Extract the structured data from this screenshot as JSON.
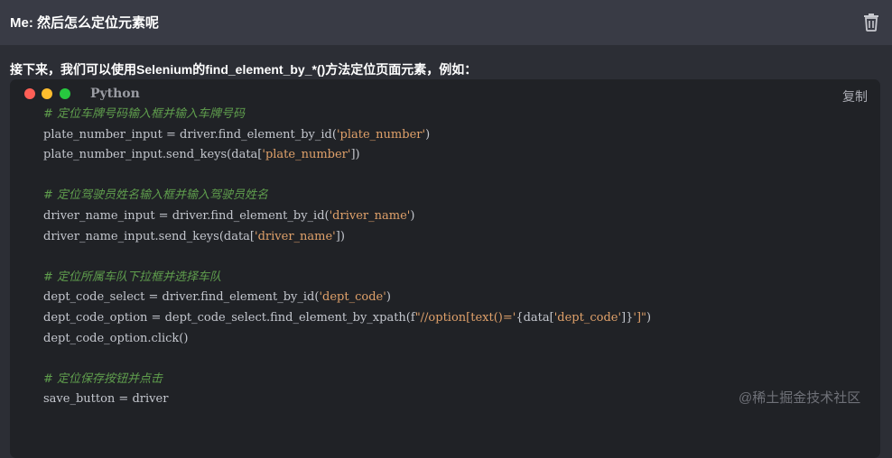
{
  "header": {
    "title": "Me: 然后怎么定位元素呢",
    "delete_icon": "trash-icon"
  },
  "answer": {
    "intro": "接下来，我们可以使用Selenium的find_element_by_*()方法定位页面元素，例如："
  },
  "code_block": {
    "language": "Python",
    "copy_label": "复制",
    "window_dots": [
      "#ff5f56",
      "#ffbd2e",
      "#27c93f"
    ],
    "lines": [
      [
        {
          "t": "comment",
          "v": "# 定位车牌号码输入框并输入车牌号码"
        }
      ],
      [
        {
          "t": "plain",
          "v": "plate_number_input = driver.find_element_by_id("
        },
        {
          "t": "string",
          "v": "'plate_number'"
        },
        {
          "t": "plain",
          "v": ")"
        }
      ],
      [
        {
          "t": "plain",
          "v": "plate_number_input.send_keys(data["
        },
        {
          "t": "string",
          "v": "'plate_number'"
        },
        {
          "t": "plain",
          "v": "])"
        }
      ],
      [],
      [
        {
          "t": "comment",
          "v": "# 定位驾驶员姓名输入框并输入驾驶员姓名"
        }
      ],
      [
        {
          "t": "plain",
          "v": "driver_name_input = driver.find_element_by_id("
        },
        {
          "t": "string",
          "v": "'driver_name'"
        },
        {
          "t": "plain",
          "v": ")"
        }
      ],
      [
        {
          "t": "plain",
          "v": "driver_name_input.send_keys(data["
        },
        {
          "t": "string",
          "v": "'driver_name'"
        },
        {
          "t": "plain",
          "v": "])"
        }
      ],
      [],
      [
        {
          "t": "comment",
          "v": "# 定位所属车队下拉框并选择车队"
        }
      ],
      [
        {
          "t": "plain",
          "v": "dept_code_select = driver.find_element_by_id("
        },
        {
          "t": "string",
          "v": "'dept_code'"
        },
        {
          "t": "plain",
          "v": ")"
        }
      ],
      [
        {
          "t": "plain",
          "v": "dept_code_option = dept_code_select.find_element_by_xpath(f"
        },
        {
          "t": "string",
          "v": "\"//option[text()='"
        },
        {
          "t": "plain",
          "v": "{data["
        },
        {
          "t": "string",
          "v": "'dept_code'"
        },
        {
          "t": "plain",
          "v": "]}"
        },
        {
          "t": "string",
          "v": "']\""
        },
        {
          "t": "plain",
          "v": ")"
        }
      ],
      [
        {
          "t": "plain",
          "v": "dept_code_option.click()"
        }
      ],
      [],
      [
        {
          "t": "comment",
          "v": "# 定位保存按钮并点击"
        }
      ],
      [
        {
          "t": "plain",
          "v": "save_button = driver"
        }
      ]
    ]
  },
  "watermark": "@稀土掘金技术社区",
  "colors": {
    "page_bg": "#2c2e35",
    "header_bg": "#393b45",
    "code_bg": "#202226",
    "comment": "#5f9e4d",
    "string": "#e0a16a",
    "code_text": "#c4c7ce"
  }
}
